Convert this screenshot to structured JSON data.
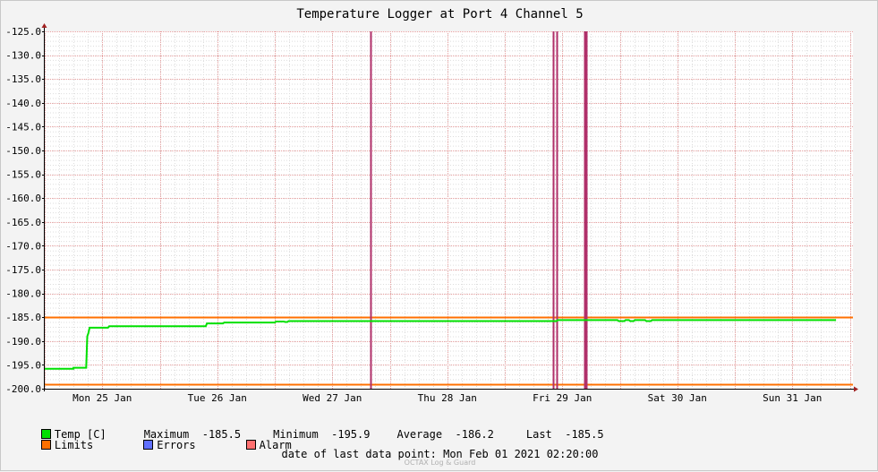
{
  "chart_data": {
    "type": "line",
    "title": "Temperature Logger at Port 4 Channel 5",
    "ylim": [
      -200.0,
      -125.0
    ],
    "y_ticks": [
      "-125.0",
      "-130.0",
      "-135.0",
      "-140.0",
      "-145.0",
      "-150.0",
      "-155.0",
      "-160.0",
      "-165.0",
      "-170.0",
      "-175.0",
      "-180.0",
      "-185.0",
      "-190.0",
      "-195.0",
      "-200.0"
    ],
    "x_ticks": [
      "Mon 25 Jan",
      "Tue 26 Jan",
      "Wed 27 Jan",
      "Thu 28 Jan",
      "Fri 29 Jan",
      "Sat 30 Jan",
      "Sun 31 Jan"
    ],
    "grid": true,
    "series": [
      {
        "name": "Temp [C]",
        "color": "#00e000",
        "points": [
          [
            0.0,
            -195.8
          ],
          [
            0.25,
            -195.8
          ],
          [
            0.25,
            -195.6
          ],
          [
            0.36,
            -195.6
          ],
          [
            0.37,
            -189.0
          ],
          [
            0.38,
            -188.3
          ],
          [
            0.39,
            -187.2
          ],
          [
            0.55,
            -187.2
          ],
          [
            0.56,
            -186.9
          ],
          [
            1.4,
            -186.9
          ],
          [
            1.41,
            -186.3
          ],
          [
            1.55,
            -186.3
          ],
          [
            1.56,
            -186.1
          ],
          [
            2.0,
            -186.1
          ],
          [
            2.01,
            -185.9
          ],
          [
            2.08,
            -185.9
          ],
          [
            2.09,
            -186.0
          ],
          [
            2.11,
            -186.0
          ],
          [
            2.12,
            -185.8
          ],
          [
            4.45,
            -185.8
          ],
          [
            4.46,
            -185.6
          ],
          [
            4.98,
            -185.6
          ],
          [
            4.99,
            -185.8
          ],
          [
            5.04,
            -185.8
          ],
          [
            5.05,
            -185.6
          ],
          [
            5.08,
            -185.6
          ],
          [
            5.09,
            -185.8
          ],
          [
            5.12,
            -185.8
          ],
          [
            5.13,
            -185.6
          ],
          [
            5.22,
            -185.6
          ],
          [
            5.23,
            -185.8
          ],
          [
            5.27,
            -185.8
          ],
          [
            5.28,
            -185.6
          ],
          [
            6.88,
            -185.6
          ]
        ]
      }
    ],
    "limits": {
      "name": "Limits",
      "color": "#ff7000",
      "upper": -185.0,
      "lower": -199.0
    },
    "errors": {
      "name": "Errors",
      "color": "#6070ff"
    },
    "alarm": {
      "name": "Alarm",
      "color": "#ff7070",
      "event_color": "#b0306a",
      "events": [
        2.83,
        4.42,
        4.45,
        4.69,
        4.71
      ]
    },
    "stats": {
      "maximum_label": "Maximum",
      "maximum": "-185.5",
      "minimum_label": "Minimum",
      "minimum": "-195.9",
      "average_label": "Average",
      "average": "-186.2",
      "last_label": "Last",
      "last": "-185.5"
    },
    "footer": {
      "label": "date of last data point:",
      "value": "Mon Feb 01 2021 02:20:00"
    },
    "watermark": "OCTAX Log & Guard"
  }
}
